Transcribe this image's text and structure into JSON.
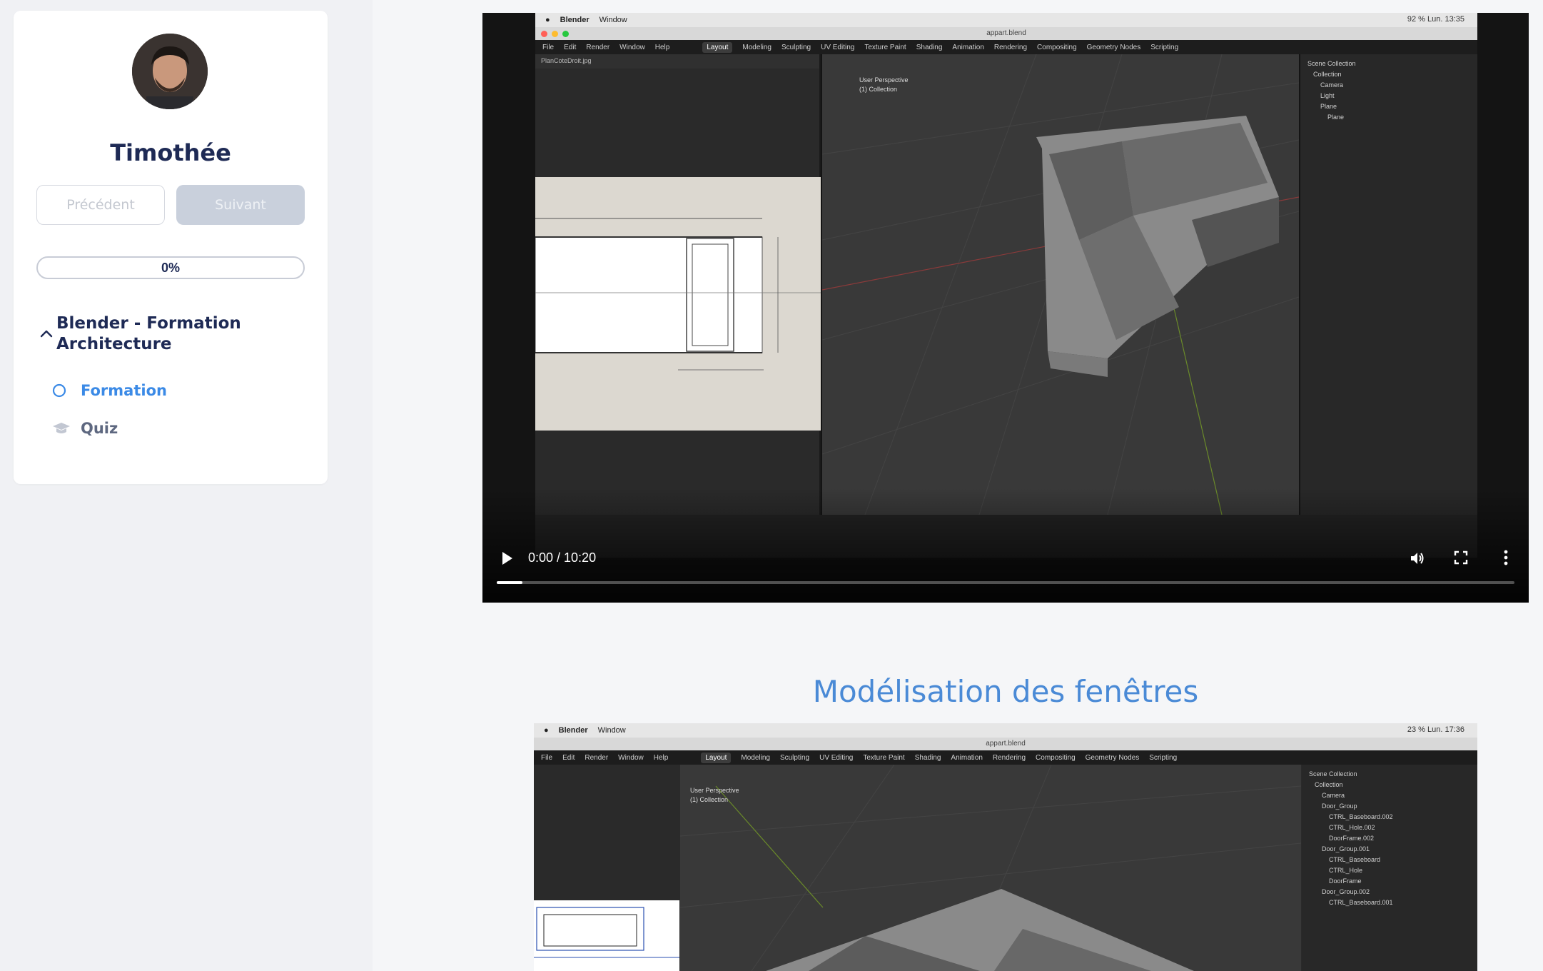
{
  "sidebar": {
    "username": "Timothée",
    "prev_label": "Précédent",
    "next_label": "Suivant",
    "progress": "0%",
    "progress_value": 0,
    "course_title": "Blender - Formation Architecture",
    "lessons": [
      {
        "label": "Formation",
        "icon": "circle-outline-icon",
        "active": true
      },
      {
        "label": "Quiz",
        "icon": "graduation-cap-icon",
        "active": false
      }
    ]
  },
  "video1": {
    "timecode": "0:00 / 10:20",
    "mac_app": "Blender",
    "mac_menu": "Window",
    "mac_status": "92 %  Lun. 13:35",
    "file_title": "appart.blend",
    "menus": [
      "File",
      "Edit",
      "Render",
      "Window",
      "Help"
    ],
    "workspaces": [
      "Layout",
      "Modeling",
      "Sculpting",
      "UV Editing",
      "Texture Paint",
      "Shading",
      "Animation",
      "Rendering",
      "Compositing",
      "Geometry Nodes",
      "Scripting"
    ],
    "image_name": "PlanCoteDroit.jpg",
    "viewport_label": "User Perspective",
    "viewport_sub": "(1) Collection",
    "outliner": [
      "Scene Collection",
      "Collection",
      "Camera",
      "Light",
      "Plane",
      "Plane"
    ]
  },
  "section_title": "Modélisation des fenêtres",
  "video2": {
    "mac_app": "Blender",
    "mac_menu": "Window",
    "mac_status": "23 %  Lun. 17:36",
    "file_title": "appart.blend",
    "menus": [
      "File",
      "Edit",
      "Render",
      "Window",
      "Help"
    ],
    "workspaces": [
      "Layout",
      "Modeling",
      "Sculpting",
      "UV Editing",
      "Texture Paint",
      "Shading",
      "Animation",
      "Rendering",
      "Compositing",
      "Geometry Nodes",
      "Scripting"
    ],
    "viewport_label": "User Perspective",
    "viewport_sub": "(1) Collection",
    "outliner": [
      "Scene Collection",
      "Collection",
      "Camera",
      "Door_Group",
      "CTRL_Baseboard.002",
      "CTRL_Hole.002",
      "DoorFrame.002",
      "Door_Group.001",
      "CTRL_Baseboard",
      "CTRL_Hole",
      "DoorFrame",
      "Door_Group.002",
      "CTRL_Baseboard.001"
    ]
  },
  "colors": {
    "accent": "#3b8ae6",
    "title_blue": "#4a8ad6",
    "navy": "#1e2a55"
  }
}
